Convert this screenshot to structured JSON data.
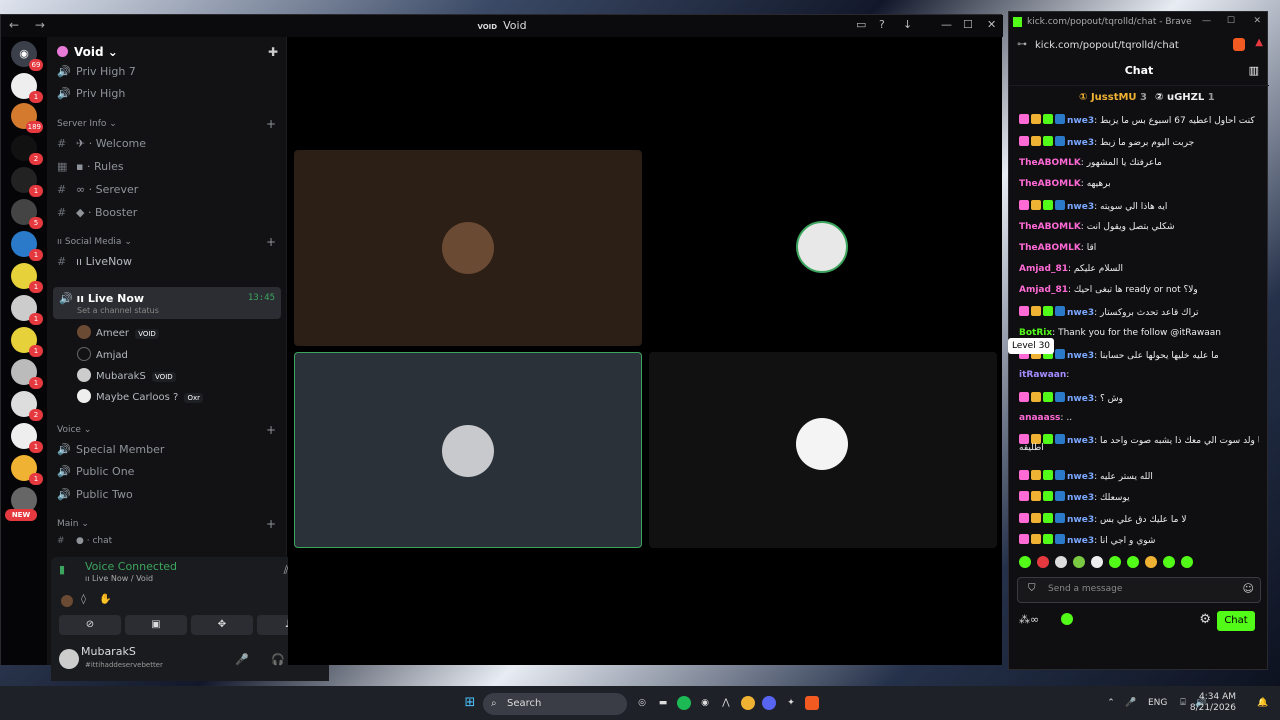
{
  "discord": {
    "window_title": "Void",
    "server_name": "Void",
    "server_badges": [
      {
        "count": "69"
      },
      {
        "count": "1"
      },
      {
        "count": "189"
      },
      {
        "count": "2"
      },
      {
        "count": "1"
      },
      {
        "count": "5"
      },
      {
        "count": "1"
      },
      {
        "count": "1"
      },
      {
        "count": "1"
      },
      {
        "count": "1"
      },
      {
        "count": "1"
      },
      {
        "count": "2"
      },
      {
        "count": "1"
      },
      {
        "count": "1"
      }
    ],
    "new_badge": "NEW",
    "channels_top": [
      "Priv High 7",
      "Priv High"
    ],
    "categories": {
      "server_info": "Server Info",
      "social_media": "Social Media",
      "voice": "Voice",
      "main": "Main"
    },
    "server_info_channels": [
      "Welcome",
      "Rules",
      "Serever",
      "Booster"
    ],
    "social_channels": [
      "LiveNow"
    ],
    "live_channel": {
      "name": "Live Now",
      "status": "Set a channel status",
      "timer": "13:45"
    },
    "members": [
      {
        "name": "Ameer",
        "tag": "VOID"
      },
      {
        "name": "Amjad",
        "tag": ""
      },
      {
        "name": "MubarakS",
        "tag": "VOID"
      },
      {
        "name": "Maybe Carloos ?",
        "tag": "Oxr"
      }
    ],
    "voice_channels": [
      "Special Member",
      "Public One",
      "Public Two"
    ],
    "main_channels": [
      "chat"
    ],
    "voice_connected": {
      "title": "Voice Connected",
      "location": "Live Now / Void"
    },
    "user": {
      "name": "MubarakS",
      "status": "#ittihaddeservebetter"
    }
  },
  "brave": {
    "title": "kick.com/popout/tqrolld/chat - Brave",
    "url": "kick.com/popout/tqrolld/chat",
    "chat_header": "Chat",
    "top_gifters": [
      {
        "rank": "1",
        "name": "JusstMU",
        "count": "3"
      },
      {
        "rank": "2",
        "name": "uGHZL",
        "count": "1"
      }
    ],
    "messages": [
      {
        "user": "nwe3",
        "color": "#7aa7ff",
        "text": "كنت احاول اعطيه 67 اسبوع بس ما يزبط"
      },
      {
        "user": "nwe3",
        "color": "#7aa7ff",
        "text": "جربت اليوم برضو ما زبط"
      },
      {
        "user": "TheABOMLK",
        "color": "#ff6ad5",
        "text": "ماعرفتك يا المشهور"
      },
      {
        "user": "TheABOMLK",
        "color": "#ff6ad5",
        "text": "برهيهه"
      },
      {
        "user": "nwe3",
        "color": "#7aa7ff",
        "text": "ايه هاذا الي سويته"
      },
      {
        "user": "TheABOMLK",
        "color": "#ff6ad5",
        "text": "شكلي بتصل ويقول انت"
      },
      {
        "user": "TheABOMLK",
        "color": "#ff6ad5",
        "text": "اقا"
      },
      {
        "user": "Amjad_81",
        "color": "#ff6ad5",
        "text": "السلام عليكم"
      },
      {
        "user": "Amjad_81",
        "color": "#ff6ad5",
        "text": "ها تبغى احيك ready or not ولا؟"
      },
      {
        "user": "nwe3",
        "color": "#7aa7ff",
        "text": "تراك قاعد تحدث بروكستار"
      },
      {
        "user": "BotRix",
        "color": "#53fc18",
        "text": "Thank you for the follow @itRawaan"
      },
      {
        "user": "nwe3",
        "color": "#7aa7ff",
        "text": "ما عليه خليها يحولها على حسابنا"
      },
      {
        "user": "itRawaan",
        "color": "#a48cff",
        "text": ""
      },
      {
        "user": "nwe3",
        "color": "#7aa7ff",
        "text": "وش ؟"
      },
      {
        "user": "anaaass",
        "color": "#ff6ad5",
        "text": ".."
      },
      {
        "user": "nwe3",
        "color": "#7aa7ff",
        "text": "يا ولد سوت الي معك ذا يشبه صوت واحد ما"
      },
      {
        "user": "nwe3",
        "color": "#7aa7ff",
        "text": "الله يستر عليه"
      },
      {
        "user": "nwe3",
        "color": "#7aa7ff",
        "text": "يوسعلك"
      },
      {
        "user": "nwe3",
        "color": "#7aa7ff",
        "text": "لا ما عليك دق علي بس"
      },
      {
        "user": "nwe3",
        "color": "#7aa7ff",
        "text": "شوي و اجي انا"
      }
    ],
    "wrap_text": "اطليقه",
    "tooltip": "Level 30",
    "input_placeholder": "Send a message",
    "chat_button": "Chat"
  },
  "taskbar": {
    "search": "Search",
    "lang": "ENG",
    "time": "4:34 AM",
    "date": "8/21/2026"
  },
  "colors": {
    "kick_green": "#53fc18",
    "discord_green": "#3ba55d",
    "badge_red": "#e5393f"
  }
}
